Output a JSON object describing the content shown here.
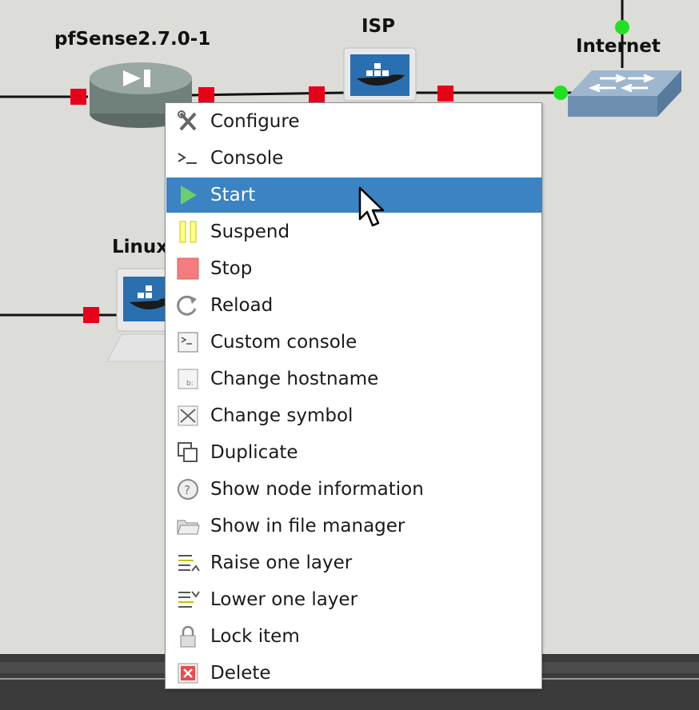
{
  "canvas": {
    "nodes": [
      {
        "label": "pfSense2.7.0-1",
        "icon": "router-icon"
      },
      {
        "label": "ISP",
        "icon": "docker-host-icon"
      },
      {
        "label": "Internet",
        "icon": "switch-icon"
      },
      {
        "label": "Linux",
        "icon": "docker-host-icon"
      }
    ]
  },
  "context_menu": {
    "items": [
      {
        "label": "Configure",
        "icon": "tools-icon"
      },
      {
        "label": "Console",
        "icon": "terminal-icon"
      },
      {
        "label": "Start",
        "icon": "play-icon",
        "highlighted": true
      },
      {
        "label": "Suspend",
        "icon": "pause-icon"
      },
      {
        "label": "Stop",
        "icon": "stop-icon"
      },
      {
        "label": "Reload",
        "icon": "reload-icon"
      },
      {
        "label": "Custom console",
        "icon": "custom-console-icon"
      },
      {
        "label": "Change hostname",
        "icon": "hostname-icon"
      },
      {
        "label": "Change symbol",
        "icon": "symbol-icon"
      },
      {
        "label": "Duplicate",
        "icon": "duplicate-icon"
      },
      {
        "label": "Show node information",
        "icon": "info-icon"
      },
      {
        "label": "Show in file manager",
        "icon": "folder-icon"
      },
      {
        "label": "Raise one layer",
        "icon": "raise-layer-icon"
      },
      {
        "label": "Lower one layer",
        "icon": "lower-layer-icon"
      },
      {
        "label": "Lock item",
        "icon": "lock-icon"
      },
      {
        "label": "Delete",
        "icon": "delete-icon"
      }
    ]
  },
  "colors": {
    "canvas_bg": "#dcdcd8",
    "highlight": "#3b83c2",
    "port_red": "#e8001a",
    "port_green": "#22e022"
  }
}
